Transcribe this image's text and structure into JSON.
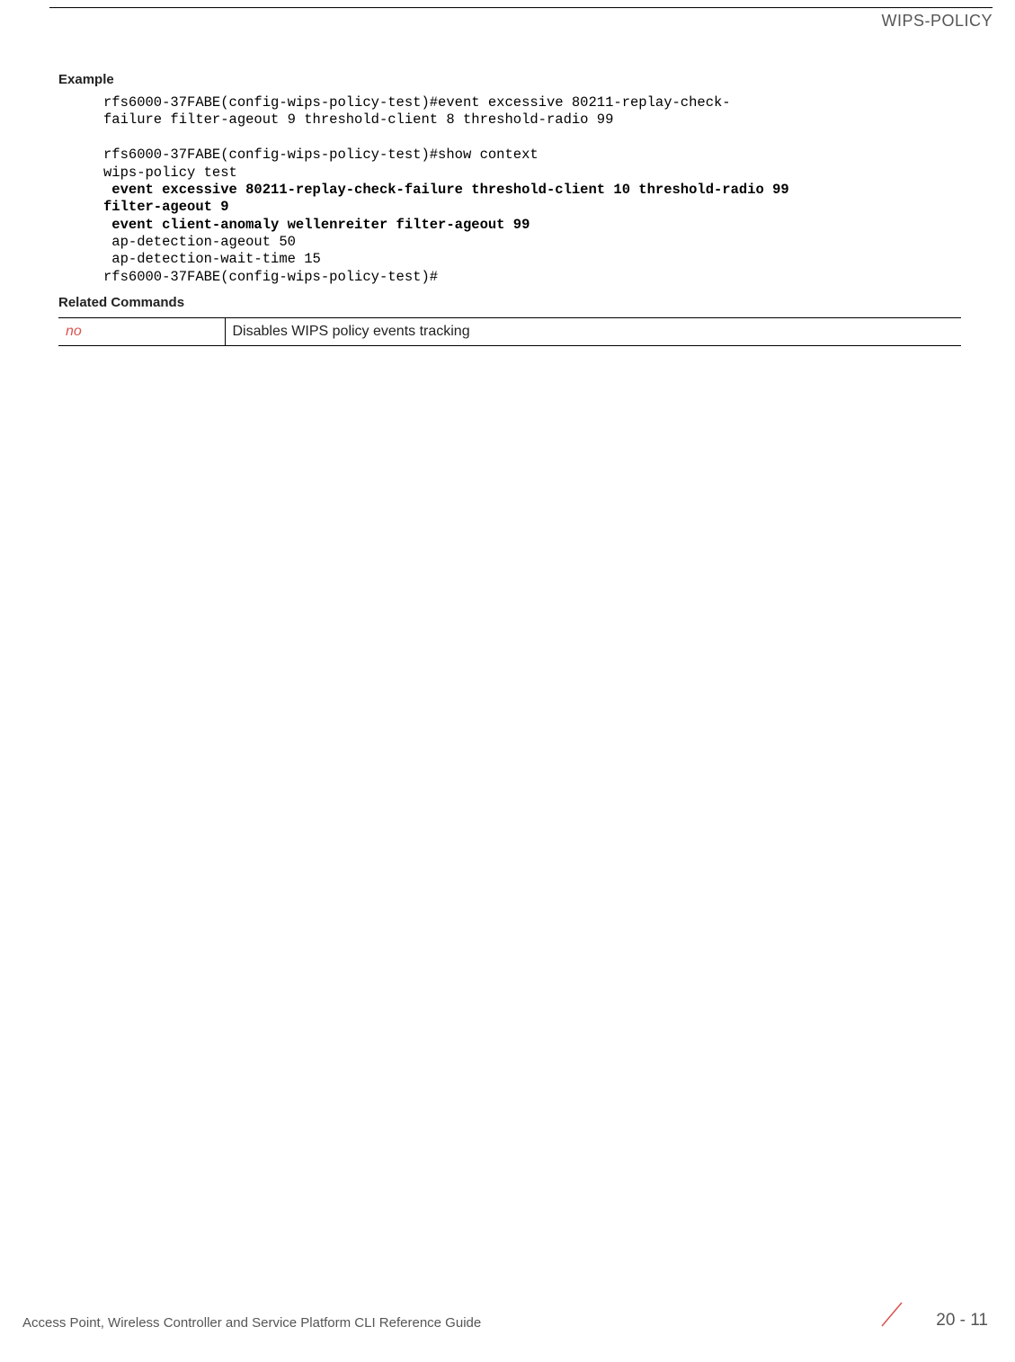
{
  "header": {
    "title": "WIPS-POLICY"
  },
  "sections": {
    "example_label": "Example",
    "related_label": "Related Commands"
  },
  "code": {
    "line1": "rfs6000-37FABE(config-wips-policy-test)#event excessive 80211-replay-check-",
    "line2": "failure filter-ageout 9 threshold-client 8 threshold-radio 99",
    "line3": "",
    "line4": "rfs6000-37FABE(config-wips-policy-test)#show context",
    "line5": "wips-policy test",
    "line6": " event excessive 80211-replay-check-failure threshold-client 10 threshold-radio 99 ",
    "line7": "filter-ageout 9",
    "line8": " event client-anomaly wellenreiter filter-ageout 99",
    "line9": " ap-detection-ageout 50",
    "line10": " ap-detection-wait-time 15",
    "line11": "rfs6000-37FABE(config-wips-policy-test)#"
  },
  "table": {
    "row1": {
      "command": "no",
      "description": "Disables WIPS policy events tracking"
    }
  },
  "footer": {
    "guide": "Access Point, Wireless Controller and Service Platform CLI Reference Guide",
    "page": "20 - 11"
  }
}
